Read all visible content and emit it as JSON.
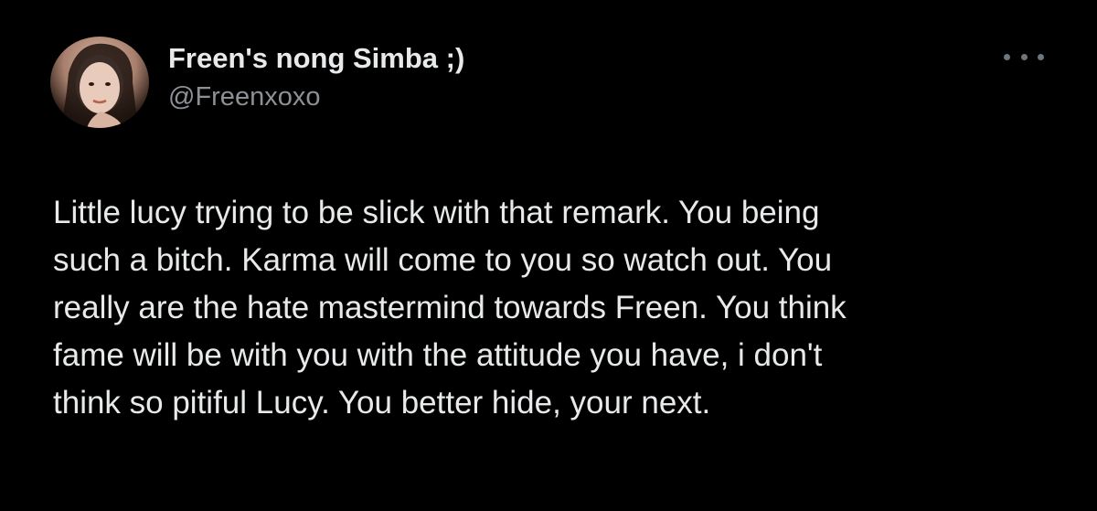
{
  "author": {
    "display_name": "Freen's nong Simba ;)",
    "handle": "@Freenxoxo",
    "avatar_icon": "profile-photo"
  },
  "menu": {
    "icon": "more-horizontal-icon"
  },
  "tweet": {
    "lines": [
      "Little lucy trying to be slick with that remark. You being",
      "such a bitch. Karma will come to you so watch out. You",
      "really are the hate mastermind towards Freen. You think",
      "fame will be with you with the attitude you have, i don't",
      "think so pitiful Lucy. You better hide, your next."
    ]
  },
  "colors": {
    "background": "#000000",
    "text_primary": "#e7e9ea",
    "text_secondary": "#8b9196"
  }
}
